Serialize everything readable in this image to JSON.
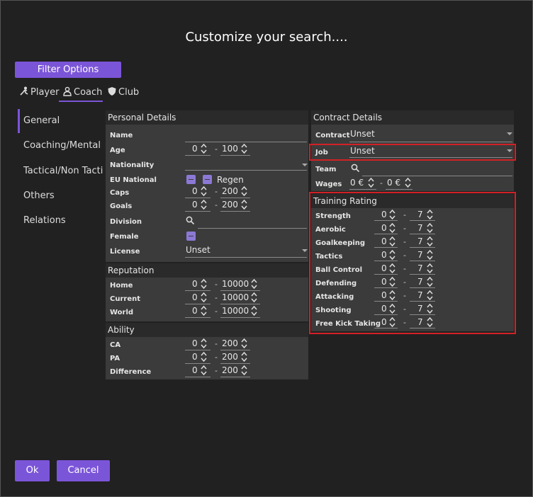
{
  "title": "Customize your search....",
  "filter_options": "Filter Options",
  "tabs": [
    "Player",
    "Coach",
    "Club"
  ],
  "sidenav": [
    "General",
    "Coaching/Mental",
    "Tactical/Non Tactic",
    "Others",
    "Relations"
  ],
  "personal": {
    "header": "Personal Details",
    "name": "Name",
    "age": {
      "label": "Age",
      "from": "0",
      "to": "100"
    },
    "nationality": "Nationality",
    "eu": "EU National",
    "regen": "Regen",
    "caps": {
      "label": "Caps",
      "from": "0",
      "to": "200"
    },
    "goals": {
      "label": "Goals",
      "from": "0",
      "to": "200"
    },
    "division": "Division",
    "female": "Female",
    "license": {
      "label": "License",
      "value": "Unset"
    }
  },
  "reputation": {
    "header": "Reputation",
    "home": {
      "label": "Home",
      "from": "0",
      "to": "10000"
    },
    "current": {
      "label": "Current",
      "from": "0",
      "to": "10000"
    },
    "world": {
      "label": "World",
      "from": "0",
      "to": "10000"
    }
  },
  "ability": {
    "header": "Ability",
    "ca": {
      "label": "CA",
      "from": "0",
      "to": "200"
    },
    "pa": {
      "label": "PA",
      "from": "0",
      "to": "200"
    },
    "diff": {
      "label": "Difference",
      "from": "0",
      "to": "200"
    }
  },
  "contract": {
    "header": "Contract Details",
    "contract": {
      "label": "Contract",
      "value": "Unset"
    },
    "job": {
      "label": "Job",
      "value": "Unset"
    },
    "team": "Team",
    "wages": {
      "label": "Wages",
      "from": "0 €",
      "to": "0 €"
    }
  },
  "training": {
    "header": "Training Rating",
    "rows": [
      {
        "label": "Strength",
        "from": "0",
        "to": "7"
      },
      {
        "label": "Aerobic",
        "from": "0",
        "to": "7"
      },
      {
        "label": "Goalkeeping",
        "from": "0",
        "to": "7"
      },
      {
        "label": "Tactics",
        "from": "0",
        "to": "7"
      },
      {
        "label": "Ball Control",
        "from": "0",
        "to": "7"
      },
      {
        "label": "Defending",
        "from": "0",
        "to": "7"
      },
      {
        "label": "Attacking",
        "from": "0",
        "to": "7"
      },
      {
        "label": "Shooting",
        "from": "0",
        "to": "7"
      },
      {
        "label": "Free Kick Taking",
        "from": "0",
        "to": "7"
      }
    ]
  },
  "ok": "Ok",
  "cancel": "Cancel",
  "colors": {
    "accent": "#7b55d8",
    "highlight": "#d32026",
    "panel": "#3b3b3b",
    "background": "#212121"
  }
}
